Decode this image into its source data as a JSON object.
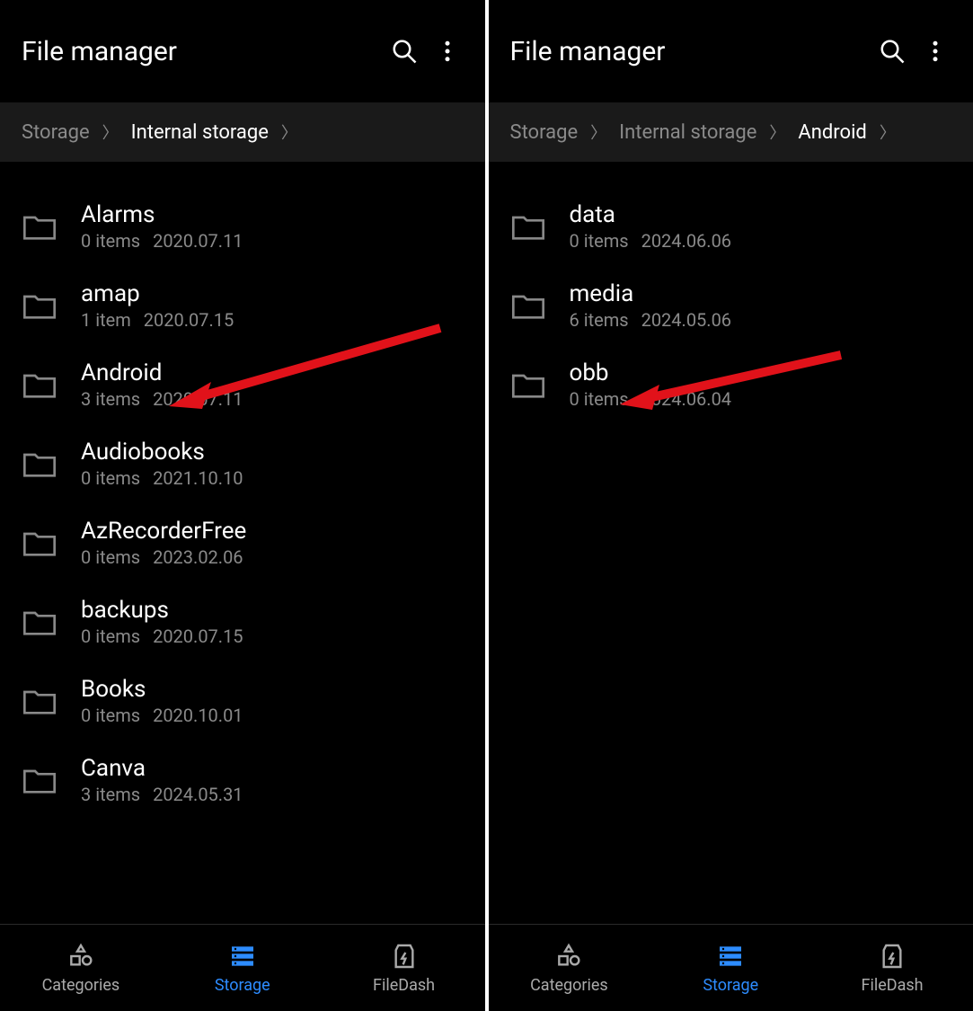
{
  "left": {
    "title": "File manager",
    "breadcrumbs": [
      {
        "label": "Storage",
        "active": false
      },
      {
        "label": "Internal storage",
        "active": true
      }
    ],
    "items": [
      {
        "name": "Alarms",
        "count": "0 items",
        "date": "2020.07.11"
      },
      {
        "name": "amap",
        "count": "1 item",
        "date": "2020.07.15"
      },
      {
        "name": "Android",
        "count": "3 items",
        "date": "2020.07.11"
      },
      {
        "name": "Audiobooks",
        "count": "0 items",
        "date": "2021.10.10"
      },
      {
        "name": "AzRecorderFree",
        "count": "0 items",
        "date": "2023.02.06"
      },
      {
        "name": "backups",
        "count": "0 items",
        "date": "2020.07.15"
      },
      {
        "name": "Books",
        "count": "0 items",
        "date": "2020.10.01"
      },
      {
        "name": "Canva",
        "count": "3 items",
        "date": "2024.05.31"
      }
    ],
    "nav": {
      "categories": "Categories",
      "storage": "Storage",
      "filedash": "FileDash"
    }
  },
  "right": {
    "title": "File manager",
    "breadcrumbs": [
      {
        "label": "Storage",
        "active": false
      },
      {
        "label": "Internal storage",
        "active": false
      },
      {
        "label": "Android",
        "active": true
      }
    ],
    "items": [
      {
        "name": "data",
        "count": "0 items",
        "date": "2024.06.06"
      },
      {
        "name": "media",
        "count": "6 items",
        "date": "2024.05.06"
      },
      {
        "name": "obb",
        "count": "0 items",
        "date": "2024.06.04"
      }
    ],
    "nav": {
      "categories": "Categories",
      "storage": "Storage",
      "filedash": "FileDash"
    }
  }
}
